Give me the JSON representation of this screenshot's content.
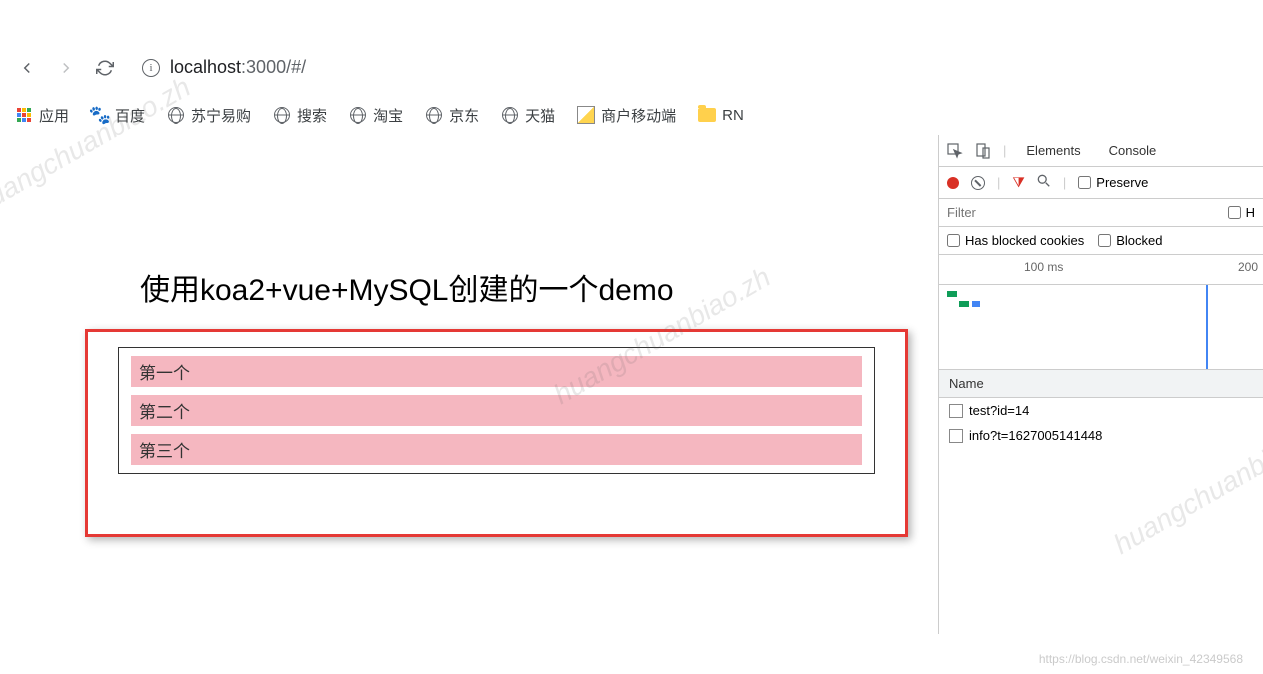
{
  "address_bar": {
    "host": "localhost",
    "port_path": ":3000/#/"
  },
  "bookmarks": [
    {
      "label": "应用",
      "icon": "apps"
    },
    {
      "label": "百度",
      "icon": "baidu"
    },
    {
      "label": "苏宁易购",
      "icon": "globe"
    },
    {
      "label": "搜索",
      "icon": "globe"
    },
    {
      "label": "淘宝",
      "icon": "globe"
    },
    {
      "label": "京东",
      "icon": "globe"
    },
    {
      "label": "天猫",
      "icon": "globe"
    },
    {
      "label": "商户移动端",
      "icon": "image"
    },
    {
      "label": "RN",
      "icon": "folder"
    }
  ],
  "page": {
    "title": "使用koa2+vue+MySQL创建的一个demo",
    "items": [
      "第一个",
      "第二个",
      "第三个"
    ]
  },
  "devtools": {
    "tabs": {
      "elements": "Elements",
      "console": "Console"
    },
    "preserve_label": "Preserve",
    "filter_placeholder": "Filter",
    "hide_label": "H",
    "blocked_cookies_label": "Has blocked cookies",
    "blocked_label": "Blocked",
    "timeline": {
      "t1": "100 ms",
      "t2": "200"
    },
    "name_header": "Name",
    "requests": [
      "test?id=14",
      "info?t=1627005141448"
    ]
  },
  "watermark": "huangchuanbiao.zh",
  "credit": "https://blog.csdn.net/weixin_42349568"
}
